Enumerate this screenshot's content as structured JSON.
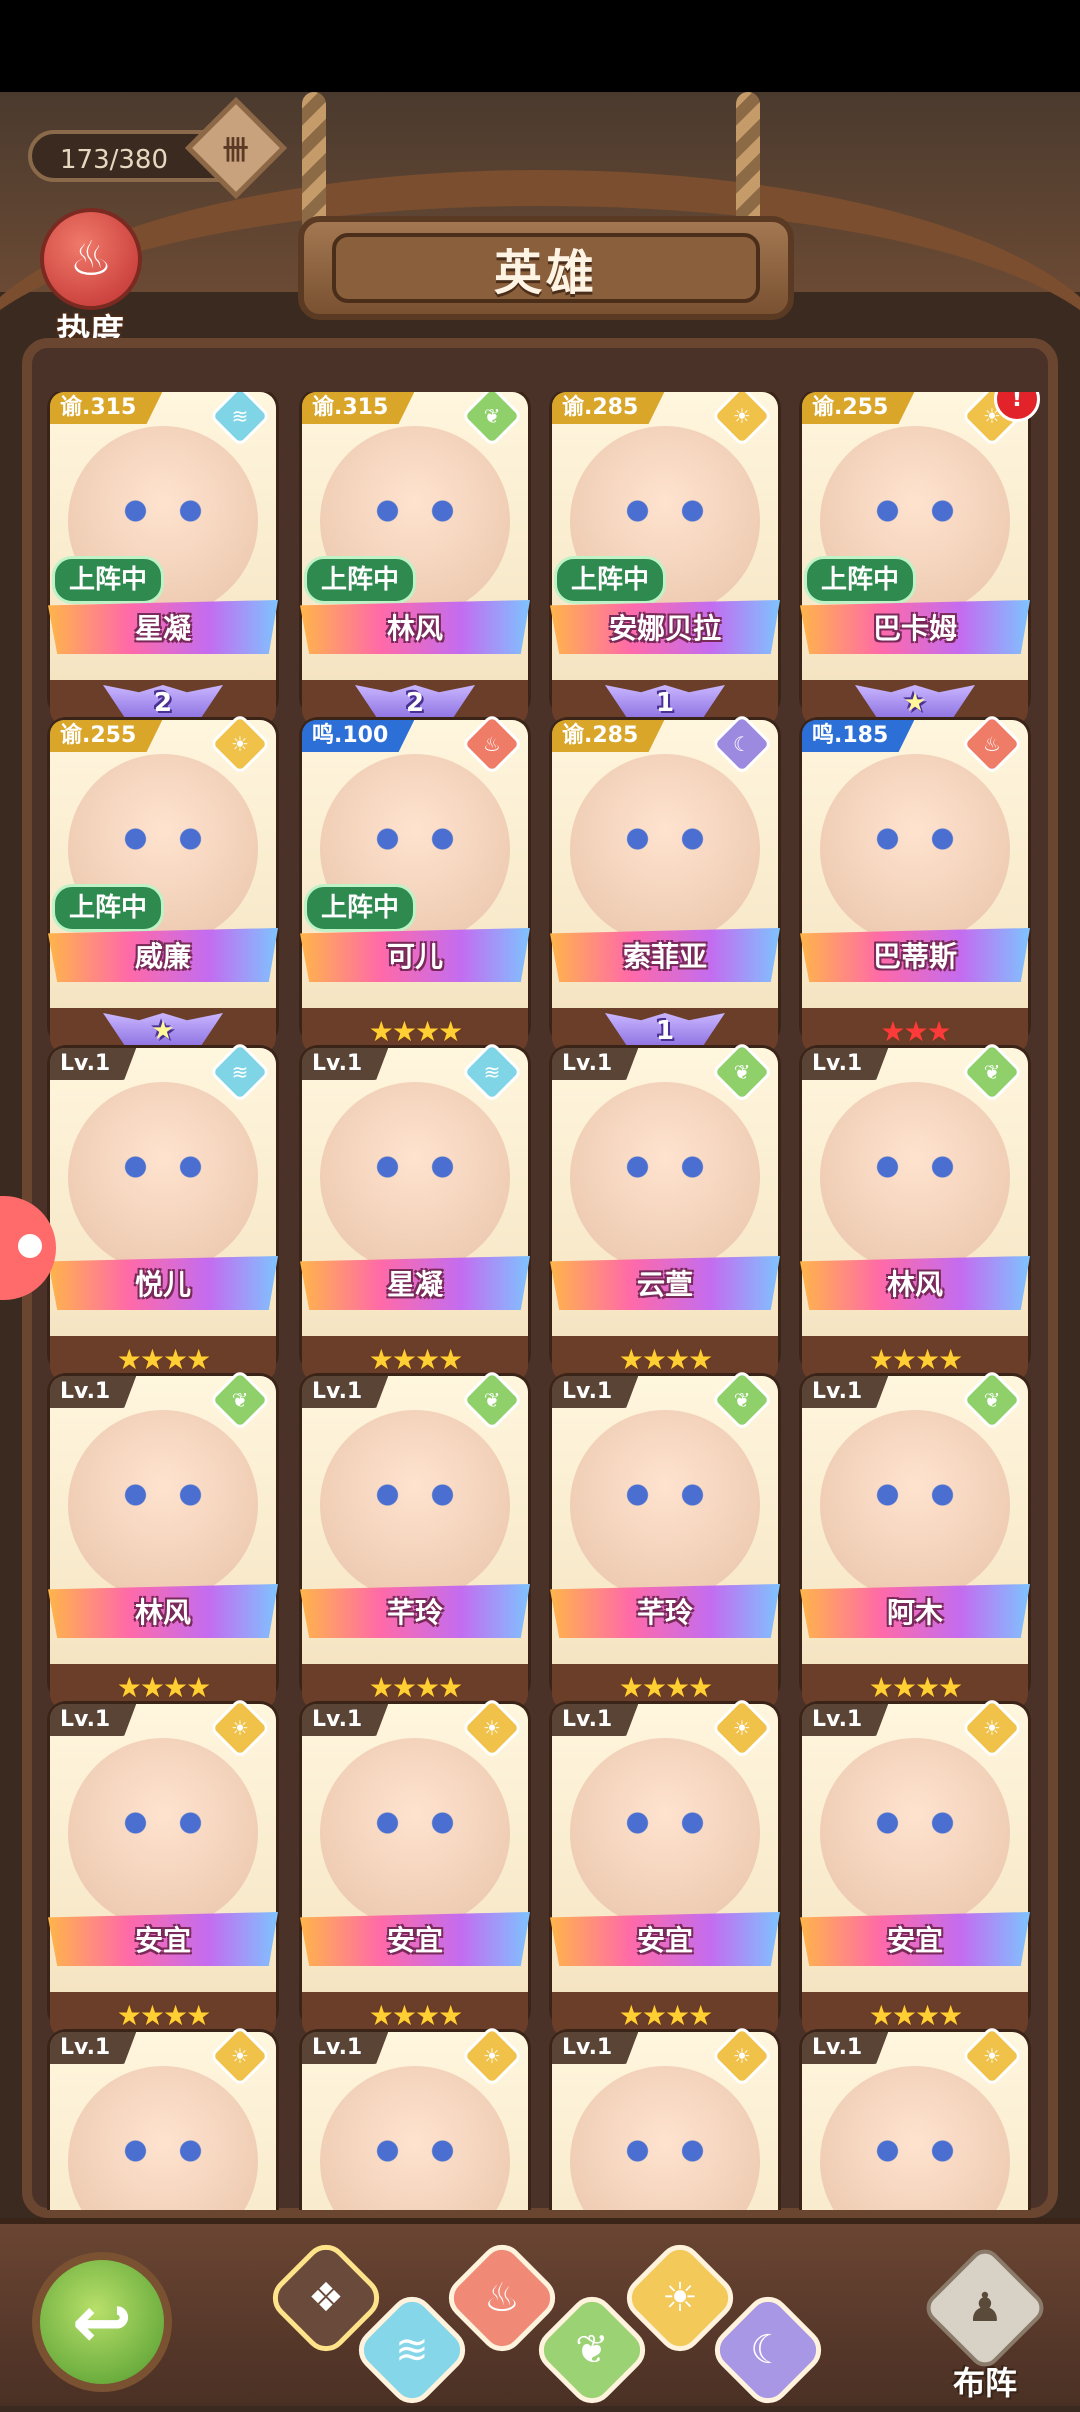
{
  "header": {
    "hero_count": "173/380",
    "title": "英雄",
    "heat_label": "热度"
  },
  "heroes": [
    {
      "name": "星凝",
      "tag": "谕.315",
      "tag_color": "gold",
      "element": "water",
      "deployed": "上阵中",
      "rank": "2",
      "rank_type": "wing"
    },
    {
      "name": "林风",
      "tag": "谕.315",
      "tag_color": "gold",
      "element": "wood",
      "deployed": "上阵中",
      "rank": "2",
      "rank_type": "wing"
    },
    {
      "name": "安娜贝拉",
      "tag": "谕.285",
      "tag_color": "gold",
      "element": "light",
      "deployed": "上阵中",
      "rank": "1",
      "rank_type": "wing"
    },
    {
      "name": "巴卡姆",
      "tag": "谕.255",
      "tag_color": "gold",
      "element": "light",
      "deployed": "上阵中",
      "rank": "★",
      "rank_type": "wing",
      "notification": "!"
    },
    {
      "name": "威廉",
      "tag": "谕.255",
      "tag_color": "gold",
      "element": "light",
      "deployed": "上阵中",
      "rank": "★",
      "rank_type": "wing"
    },
    {
      "name": "可儿",
      "tag": "鸣.100",
      "tag_color": "blue",
      "element": "fire",
      "deployed": "上阵中",
      "rank": "★★★★",
      "rank_type": "stars"
    },
    {
      "name": "索菲亚",
      "tag": "谕.285",
      "tag_color": "gold",
      "element": "moon",
      "deployed": "",
      "rank": "1",
      "rank_type": "wing"
    },
    {
      "name": "巴蒂斯",
      "tag": "鸣.185",
      "tag_color": "blue",
      "element": "fire",
      "deployed": "",
      "rank": "★★★",
      "rank_type": "red-stars"
    },
    {
      "name": "悦儿",
      "tag": "Lv.1",
      "tag_color": "dark",
      "element": "water",
      "deployed": "",
      "rank": "★★★★",
      "rank_type": "stars"
    },
    {
      "name": "星凝",
      "tag": "Lv.1",
      "tag_color": "dark",
      "element": "water",
      "deployed": "",
      "rank": "★★★★",
      "rank_type": "stars"
    },
    {
      "name": "云萱",
      "tag": "Lv.1",
      "tag_color": "dark",
      "element": "wood",
      "deployed": "",
      "rank": "★★★★",
      "rank_type": "stars"
    },
    {
      "name": "林风",
      "tag": "Lv.1",
      "tag_color": "dark",
      "element": "wood",
      "deployed": "",
      "rank": "★★★★",
      "rank_type": "stars"
    },
    {
      "name": "林风",
      "tag": "Lv.1",
      "tag_color": "dark",
      "element": "wood",
      "deployed": "",
      "rank": "★★★★",
      "rank_type": "stars"
    },
    {
      "name": "芊玲",
      "tag": "Lv.1",
      "tag_color": "dark",
      "element": "wood",
      "deployed": "",
      "rank": "★★★★",
      "rank_type": "stars"
    },
    {
      "name": "芊玲",
      "tag": "Lv.1",
      "tag_color": "dark",
      "element": "wood",
      "deployed": "",
      "rank": "★★★★",
      "rank_type": "stars"
    },
    {
      "name": "阿木",
      "tag": "Lv.1",
      "tag_color": "dark",
      "element": "wood",
      "deployed": "",
      "rank": "★★★★",
      "rank_type": "stars"
    },
    {
      "name": "安宜",
      "tag": "Lv.1",
      "tag_color": "dark",
      "element": "light",
      "deployed": "",
      "rank": "★★★★",
      "rank_type": "stars"
    },
    {
      "name": "安宜",
      "tag": "Lv.1",
      "tag_color": "dark",
      "element": "light",
      "deployed": "",
      "rank": "★★★★",
      "rank_type": "stars"
    },
    {
      "name": "安宜",
      "tag": "Lv.1",
      "tag_color": "dark",
      "element": "light",
      "deployed": "",
      "rank": "★★★★",
      "rank_type": "stars"
    },
    {
      "name": "安宜",
      "tag": "Lv.1",
      "tag_color": "dark",
      "element": "light",
      "deployed": "",
      "rank": "★★★★",
      "rank_type": "stars"
    },
    {
      "name": "",
      "tag": "Lv.1",
      "tag_color": "dark",
      "element": "light",
      "deployed": "",
      "rank": "",
      "rank_type": "none"
    },
    {
      "name": "",
      "tag": "Lv.1",
      "tag_color": "dark",
      "element": "light",
      "deployed": "",
      "rank": "",
      "rank_type": "none"
    },
    {
      "name": "",
      "tag": "Lv.1",
      "tag_color": "dark",
      "element": "light",
      "deployed": "",
      "rank": "",
      "rank_type": "none"
    },
    {
      "name": "",
      "tag": "Lv.1",
      "tag_color": "dark",
      "element": "light",
      "deployed": "",
      "rank": "",
      "rank_type": "none"
    }
  ],
  "element_icons": {
    "water": "≋",
    "wood": "❦",
    "light": "☀",
    "fire": "♨",
    "moon": "☾"
  },
  "filters": [
    {
      "id": "all",
      "icon": "❖"
    },
    {
      "id": "water",
      "icon": "≋"
    },
    {
      "id": "fire",
      "icon": "♨"
    },
    {
      "id": "wood",
      "icon": "❦"
    },
    {
      "id": "light",
      "icon": "☀"
    },
    {
      "id": "moon",
      "icon": "☾"
    }
  ],
  "footer": {
    "back_icon": "↩",
    "formation_icon": "♟",
    "formation_label": "布阵"
  }
}
